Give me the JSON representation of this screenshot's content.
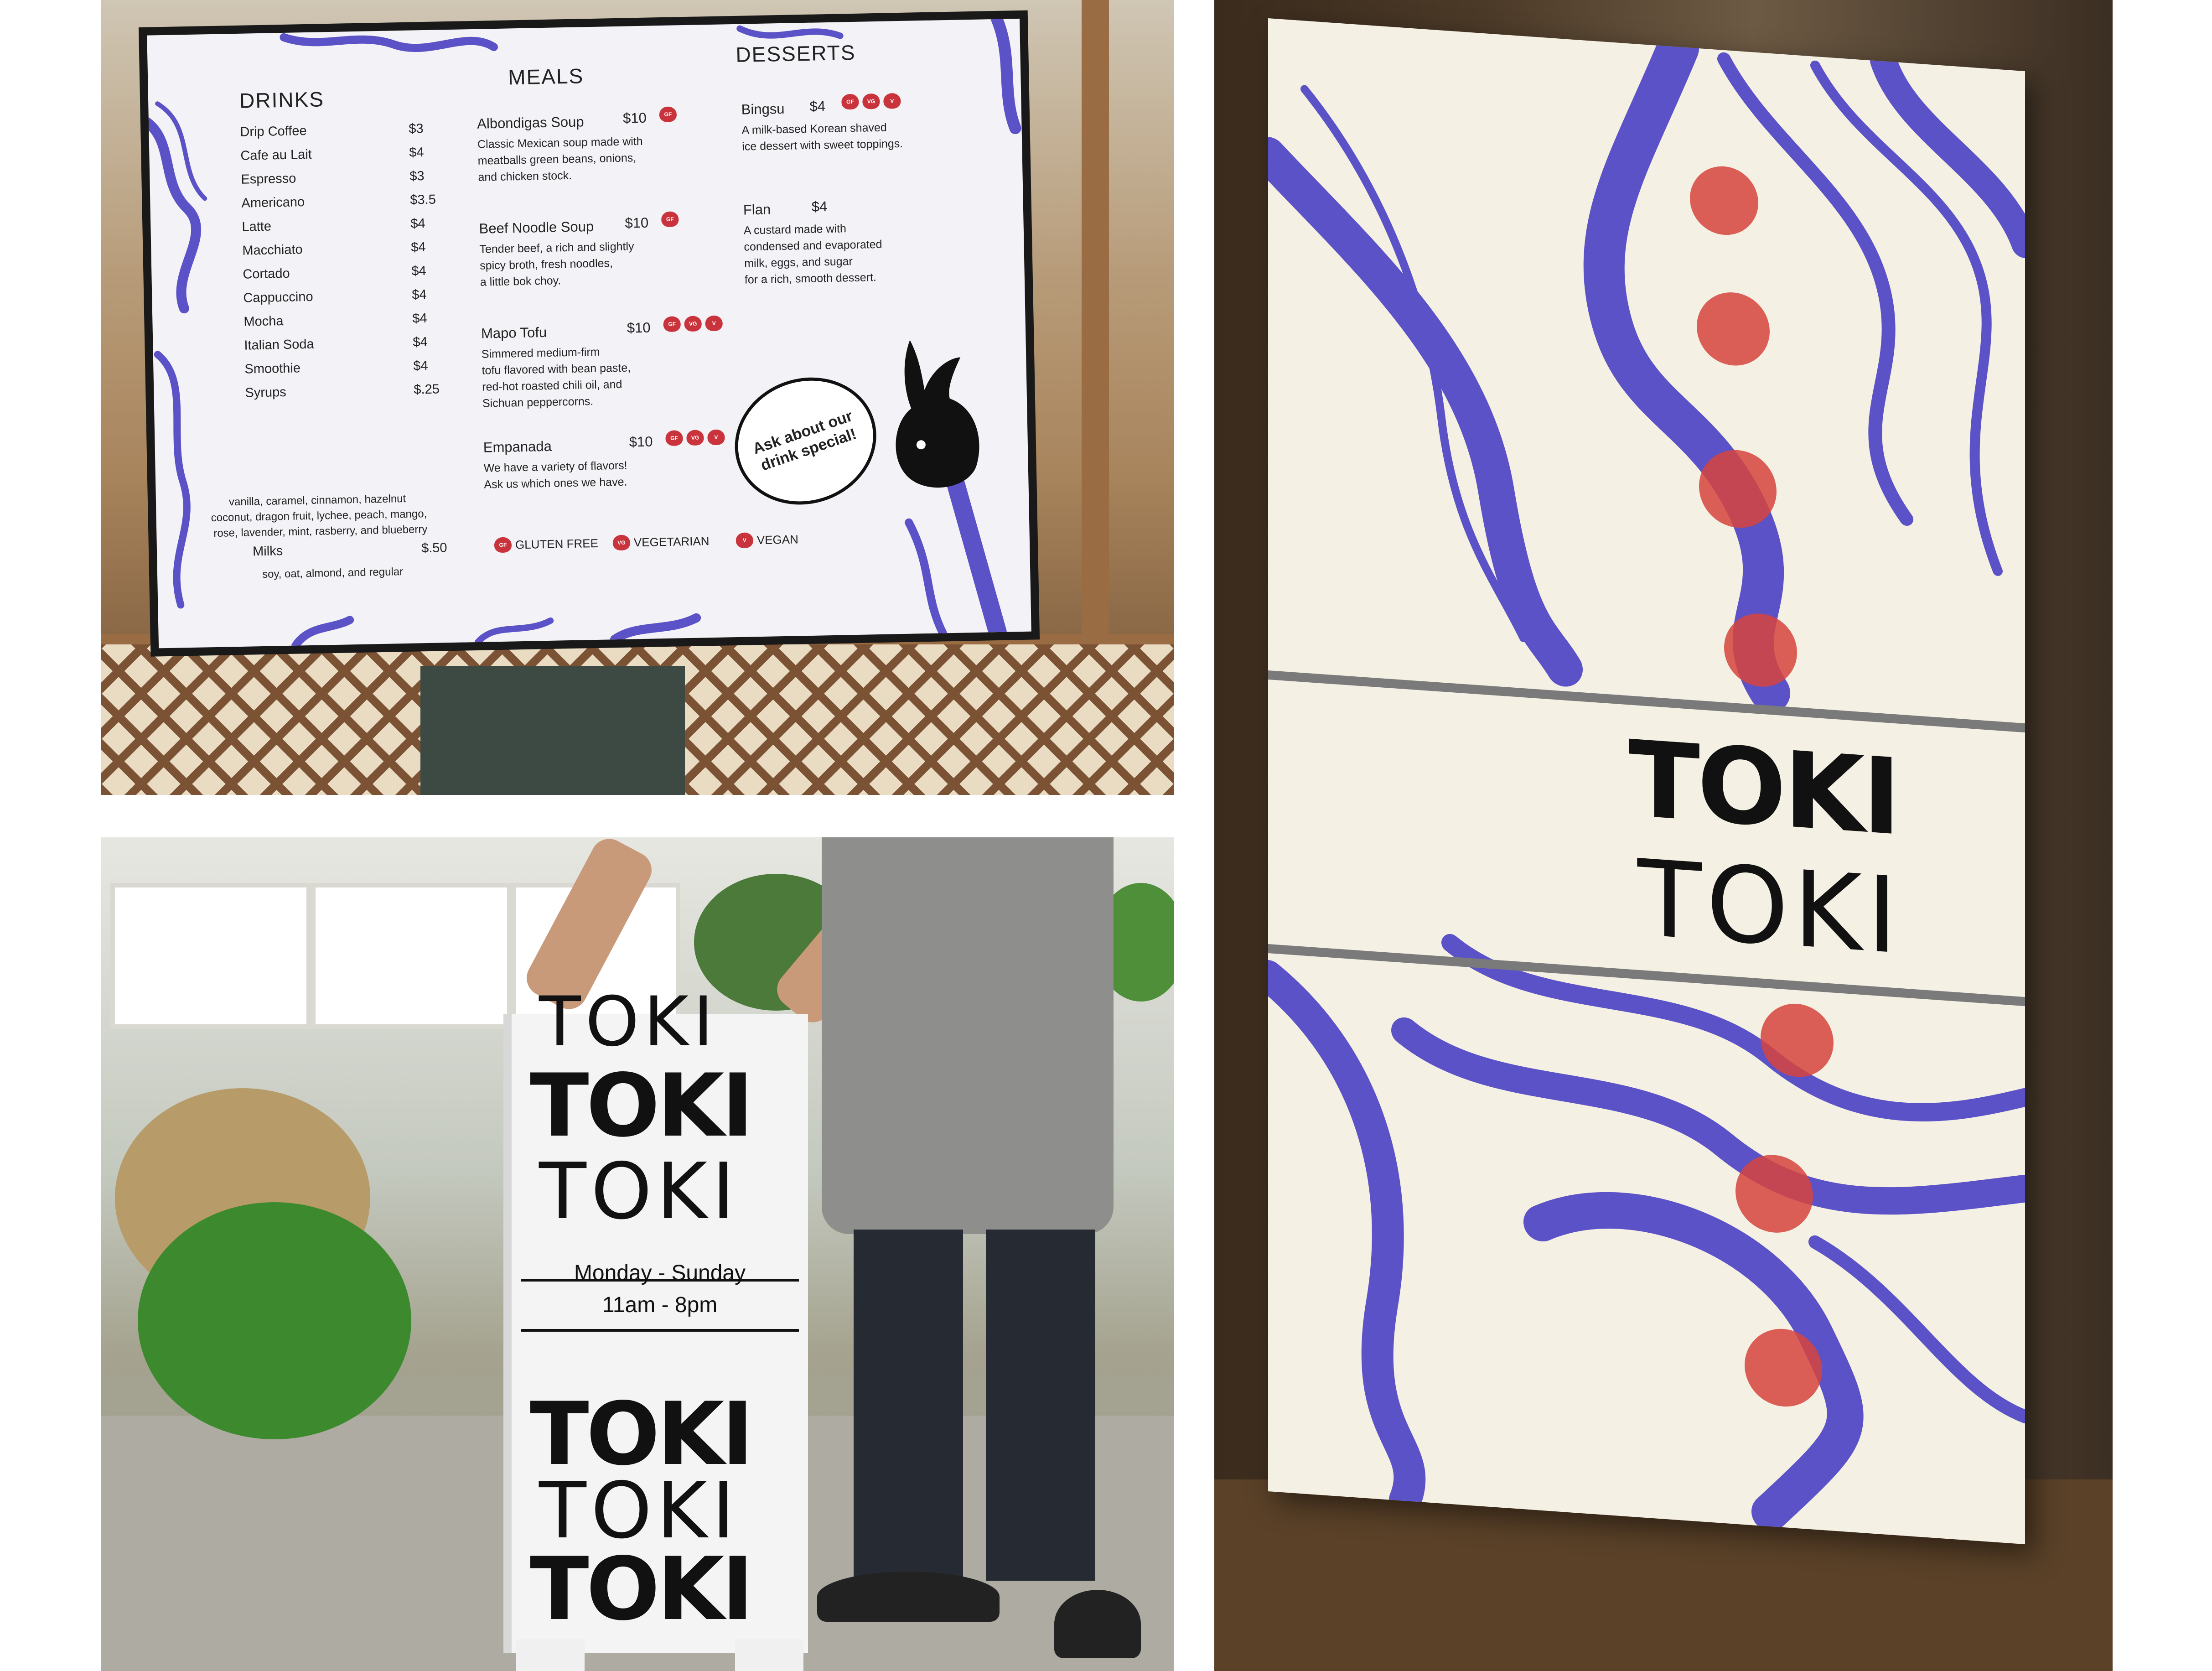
{
  "menu_board": {
    "drinks": {
      "title": "DRINKS",
      "items": [
        {
          "name": "Drip Coffee",
          "price": "$3"
        },
        {
          "name": "Cafe au Lait",
          "price": "$4"
        },
        {
          "name": "Espresso",
          "price": "$3"
        },
        {
          "name": "Americano",
          "price": "$3.5"
        },
        {
          "name": "Latte",
          "price": "$4"
        },
        {
          "name": "Macchiato",
          "price": "$4"
        },
        {
          "name": "Cortado",
          "price": "$4"
        },
        {
          "name": "Cappuccino",
          "price": "$4"
        },
        {
          "name": "Mocha",
          "price": "$4"
        },
        {
          "name": "Italian Soda",
          "price": "$4"
        },
        {
          "name": "Smoothie",
          "price": "$4"
        },
        {
          "name": "Syrups",
          "price": "$.25"
        }
      ],
      "syrups_line1": "vanilla, caramel, cinnamon, hazelnut",
      "syrups_line2": "coconut, dragon fruit, lychee, peach, mango,",
      "syrups_line3": "rose, lavender, mint, rasberry, and blueberry",
      "milks": {
        "name": "Milks",
        "price": "$.50"
      },
      "milks_desc": "soy, oat, almond, and regular"
    },
    "meals": {
      "title": "MEALS",
      "items": [
        {
          "name": "Albondigas Soup",
          "price": "$10",
          "tags": [
            "GF"
          ],
          "desc": "Classic Mexican soup made with\nmeatballs green beans, onions,\nand chicken stock."
        },
        {
          "name": "Beef Noodle Soup",
          "price": "$10",
          "tags": [
            "GF"
          ],
          "desc": "Tender beef, a rich and slightly\nspicy broth, fresh noodles,\na little bok choy."
        },
        {
          "name": "Mapo Tofu",
          "price": "$10",
          "tags": [
            "GF",
            "VG",
            "V"
          ],
          "desc": "Simmered medium-firm\ntofu flavored with bean paste,\nred-hot roasted chili oil, and\nSichuan peppercorns."
        },
        {
          "name": "Empanada",
          "price": "$10",
          "tags": [
            "GF",
            "VG",
            "V"
          ],
          "desc": "We have a variety of flavors!\nAsk us which ones we have."
        }
      ]
    },
    "desserts": {
      "title": "DESSERTS",
      "items": [
        {
          "name": "Bingsu",
          "price": "$4",
          "tags": [
            "GF",
            "VG",
            "V"
          ],
          "desc": "A milk-based Korean shaved\nice dessert with sweet toppings."
        },
        {
          "name": "Flan",
          "price": "$4",
          "tags": [],
          "desc": "A custard made with\ncondensed and evaporated\nmilk, eggs, and sugar\nfor a rich, smooth dessert."
        }
      ]
    },
    "legend": [
      {
        "tag": "GF",
        "label": "GLUTEN FREE"
      },
      {
        "tag": "VG",
        "label": "VEGETARIAN"
      },
      {
        "tag": "V",
        "label": "VEGAN"
      }
    ],
    "bubble_text": "Ask about our drink special!"
  },
  "a_board": {
    "logo_solid": "TOKI",
    "logo_thin": "TOKI",
    "hours_days": "Monday - Sunday",
    "hours_time": "11am - 8pm"
  },
  "poster": {
    "logo_solid": "TOKI",
    "logo_thin": "TOKI"
  },
  "colors": {
    "brand_blue": "#5a52c6",
    "brand_red": "#d6443d",
    "ink": "#111111",
    "paper": "#f5f0e4"
  }
}
